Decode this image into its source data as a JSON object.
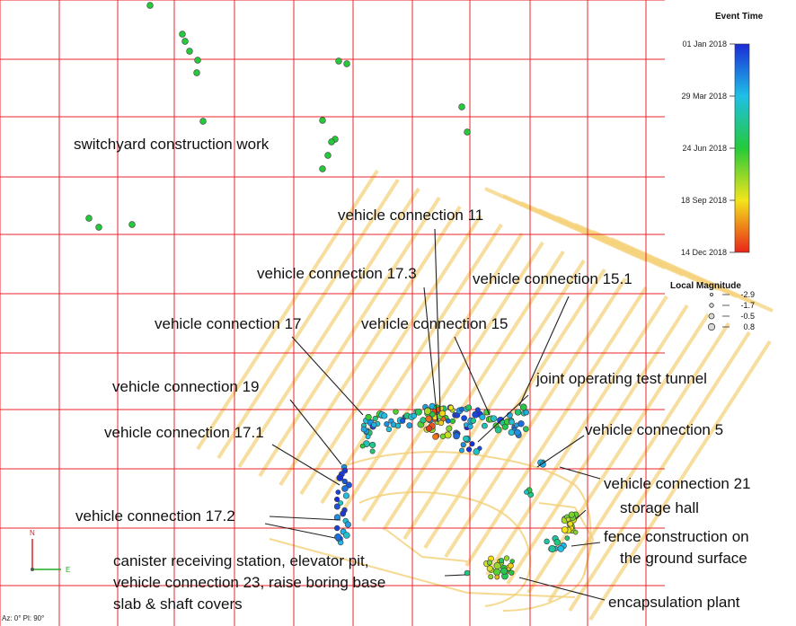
{
  "chart_data": {
    "type": "scatter",
    "title": "",
    "xlabel": "",
    "ylabel": "",
    "grid": true,
    "colorbar": {
      "title": "Event Time",
      "ticks": [
        "01 Jan 2018",
        "29 Mar 2018",
        "24 Jun 2018",
        "18 Sep 2018",
        "14 Dec 2018"
      ],
      "colors": [
        "#1a2bd6",
        "#1fc0e6",
        "#25c93a",
        "#f3e51b",
        "#e8251a"
      ]
    },
    "size_legend": {
      "title": "Local Magnitude",
      "values": [
        "-2.9",
        "-1.7",
        "-0.5",
        "0.8"
      ]
    },
    "axes_indicator": {
      "north": "N",
      "east": "E"
    },
    "view_label": "Az: 0° Pl: 90°",
    "annotations": [
      "switchyard construction work",
      "vehicle connection 11",
      "vehicle connection 17.3",
      "vehicle connection 15.1",
      "vehicle connection 17",
      "vehicle connection 15",
      "vehicle connection 19",
      "joint operating test tunnel",
      "vehicle connection 17.1",
      "vehicle connection 5",
      "vehicle connection 21",
      "storage hall",
      "vehicle connection 17.2",
      "fence construction on",
      "the ground surface",
      "canister receiving station, elevator pit,",
      "vehicle connection 23, raise boring base",
      "slab & shaft covers",
      "encapsulation plant"
    ]
  },
  "colors": {
    "grid": "#e8262b",
    "tunnels": "#f6d37d",
    "axis_north": "#d22",
    "axis_east": "#2a2"
  }
}
